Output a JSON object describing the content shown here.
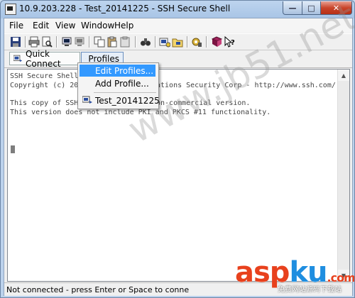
{
  "window": {
    "title": "10.9.203.228 - Test_20141225 - SSH Secure Shell"
  },
  "menu": [
    "File",
    "Edit",
    "View",
    "Window",
    "Help"
  ],
  "toolbar_icons": [
    "save-icon",
    "print-icon",
    "print-preview-icon",
    "connect-icon",
    "disconnect-icon",
    "copy-icon",
    "paste-icon",
    "clipboard-icon",
    "find-icon",
    "profile-settings-icon",
    "profile-folder-icon",
    "settings-gear-icon",
    "help-book-icon",
    "context-help-icon"
  ],
  "quickbar": {
    "quick_connect": "Quick Connect",
    "profiles": "Profiles"
  },
  "terminal": {
    "lines": [
      "SSH Secure Shell",
      "Copyright (c) 200",
      "ations Security Corp - http://www.ssh.com/",
      "This copy of SSH",
      "on-commercial version.",
      "This version does not include PKI and PKCS #11 functionality."
    ]
  },
  "dropdown": {
    "items": [
      "Edit Profiles...",
      "Add Profile...",
      "Test_20141225"
    ]
  },
  "status": {
    "text": "Not connected - press Enter or Space to conne"
  },
  "watermark": "www.jb51.net",
  "brand": {
    "asp": "asp",
    "ku": "ku",
    "com": ".com",
    "subtitle": "免费网站源码下载站"
  },
  "colors": {
    "highlight": "#3399ff",
    "close_button": "#c9442a",
    "brand_asp": "#e8411d",
    "brand_ku": "#1f8ee0"
  }
}
